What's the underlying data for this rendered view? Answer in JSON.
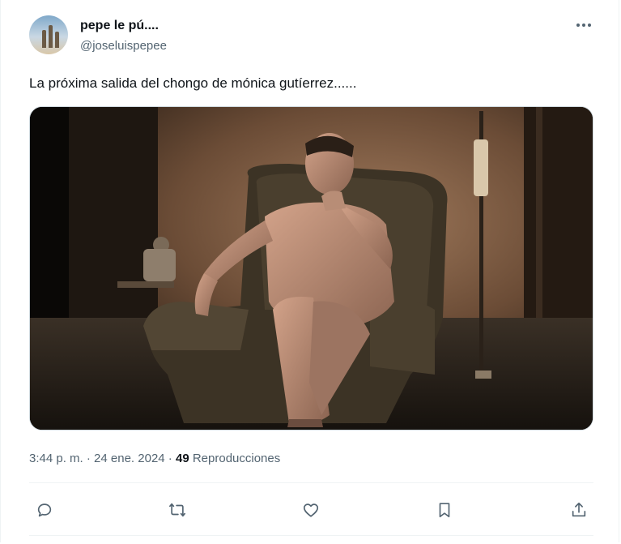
{
  "author": {
    "name": "pepe le pú....",
    "handle": "@joseluispepee"
  },
  "tweet": {
    "text": "La próxima salida del chongo de mónica gutíerrez......"
  },
  "meta": {
    "time": "3:44 p. m.",
    "sep1": " · ",
    "date": "24 ene. 2024",
    "sep2": " · ",
    "views_count": "49",
    "views_label": " Reproducciones"
  },
  "actions": {
    "reply": "reply-icon",
    "retweet": "retweet-icon",
    "like": "heart-icon",
    "bookmark": "bookmark-icon",
    "share": "share-icon"
  },
  "colors": {
    "text": "#0f1419",
    "secondary": "#536471",
    "border": "#eff3f4"
  }
}
